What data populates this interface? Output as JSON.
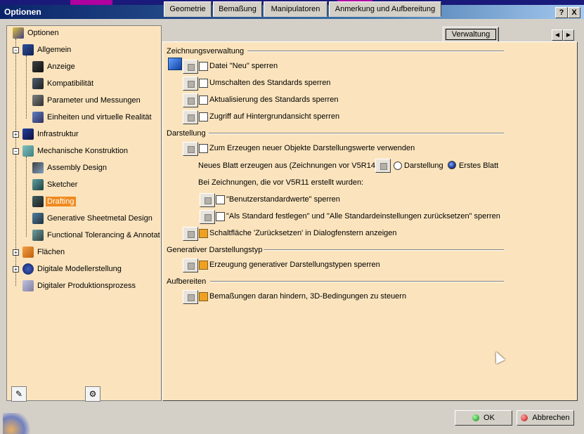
{
  "window": {
    "title": "Optionen",
    "help_label": "?",
    "close_label": "X"
  },
  "tree": {
    "items": [
      {
        "label": "Optionen"
      },
      {
        "label": "Allgemein"
      },
      {
        "label": "Anzeige"
      },
      {
        "label": "Kompatibilität"
      },
      {
        "label": "Parameter und Messungen"
      },
      {
        "label": "Einheiten und virtuelle Realität"
      },
      {
        "label": "Infrastruktur"
      },
      {
        "label": "Mechanische Konstruktion"
      },
      {
        "label": "Assembly Design"
      },
      {
        "label": "Sketcher"
      },
      {
        "label": "Drafting",
        "selected": true
      },
      {
        "label": "Generative Sheetmetal Design"
      },
      {
        "label": "Functional Tolerancing & Annotat"
      },
      {
        "label": "Flächen"
      },
      {
        "label": "Digitale Modellerstellung"
      },
      {
        "label": "Digitaler Produktionsprozess"
      }
    ]
  },
  "tabs": [
    {
      "label": "Geometrie"
    },
    {
      "label": "Bemaßung"
    },
    {
      "label": "Manipulatoren"
    },
    {
      "label": "Anmerkung und Aufbereitung"
    },
    {
      "label": "Verwaltung",
      "active": true
    }
  ],
  "groups": {
    "zeichnungsverwaltung": {
      "title": "Zeichnungsverwaltung",
      "rows": [
        {
          "label": "Datei \"Neu\" sperren",
          "checked": false
        },
        {
          "label": "Umschalten des Standards sperren",
          "checked": false
        },
        {
          "label": "Aktualisierung des Standards sperren",
          "checked": false
        },
        {
          "label": "Zugriff auf Hintergrundansicht sperren",
          "checked": false
        }
      ]
    },
    "darstellung": {
      "title": "Darstellung",
      "row1": "Zum Erzeugen neuer Objekte Darstellungswerte verwenden",
      "new_sheet_label": "Neues Blatt erzeugen aus (Zeichnungen vor V5R14):",
      "radio_options": [
        "Darstellung",
        "Erstes Blatt"
      ],
      "radio_selected": "Erstes Blatt",
      "older_label": "Bei Zeichnungen, die vor V5R11 erstellt wurden:",
      "older_rows": [
        "\"Benutzerstandardwerte\" sperren",
        "\"Als Standard festlegen\" und \"Alle Standardeinstellungen zurücksetzen\" sperren"
      ],
      "reset_row": "Schaltfläche 'Zurücksetzen' in Dialogfenstern anzeigen"
    },
    "generativer": {
      "title": "Generativer Darstellungstyp",
      "row": "Erzeugung generativer Darstellungstypen sperren"
    },
    "aufbereiten": {
      "title": "Aufbereiten",
      "row": "Bemaßungen daran hindern, 3D-Bedingungen zu steuern"
    }
  },
  "buttons": {
    "ok": "OK",
    "cancel": "Abbrechen"
  }
}
